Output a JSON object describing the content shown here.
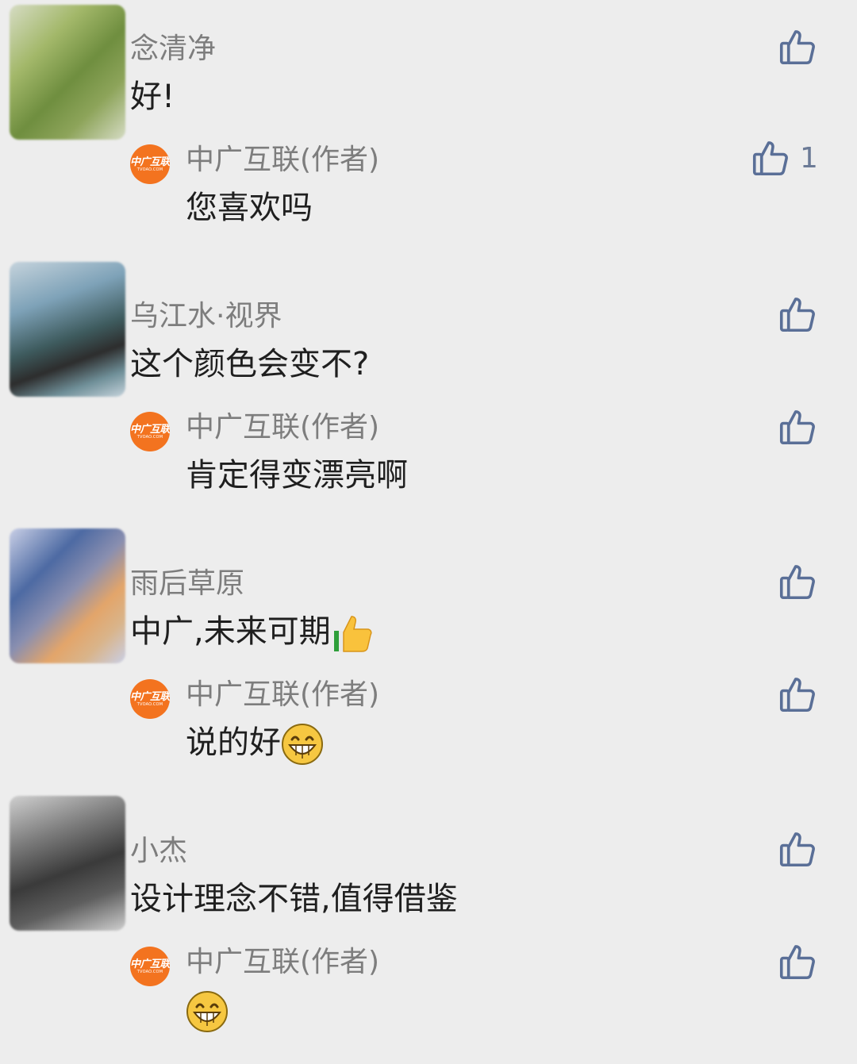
{
  "comments": [
    {
      "name": "念清净",
      "text": "好!",
      "avatar_colors": [
        "#6f8e3f",
        "#a3b86a",
        "#d6dcc4"
      ],
      "reply": {
        "name": "中广互联(作者)",
        "text": "您喜欢吗",
        "likes": "1"
      }
    },
    {
      "name": "乌江水·视界",
      "text": "这个颜色会变不?",
      "avatar_colors": [
        "#3e5b5e",
        "#7ea2b8",
        "#c5d3dc"
      ],
      "reply": {
        "name": "中广互联(作者)",
        "text": "肯定得变漂亮啊",
        "likes": ""
      }
    },
    {
      "name": "雨后草原",
      "text": "中广,未来可期",
      "text_emoji": "thumbs-up-emoji",
      "avatar_colors": [
        "#4d6aa3",
        "#e3a56a",
        "#c9cfe6"
      ],
      "reply": {
        "name": "中广互联(作者)",
        "text": "说的好",
        "text_emoji": "grinning-face-emoji",
        "likes": ""
      }
    },
    {
      "name": "小杰",
      "text": "设计理念不错,值得借鉴",
      "avatar_colors": [
        "#3a3a3a",
        "#7b7b7b",
        "#cfcfcf"
      ],
      "reply": {
        "name": "中广互联(作者)",
        "text": "",
        "text_emoji": "grinning-face-emoji",
        "likes": ""
      }
    }
  ],
  "reply_avatar": {
    "line1": "中广互联",
    "line2": "TVOAO.COM",
    "color": "#f3731f"
  },
  "colors": {
    "like_icon": "#5a6f97",
    "name": "#7d7d7d",
    "text": "#1f1f1f",
    "background": "#ededed"
  }
}
